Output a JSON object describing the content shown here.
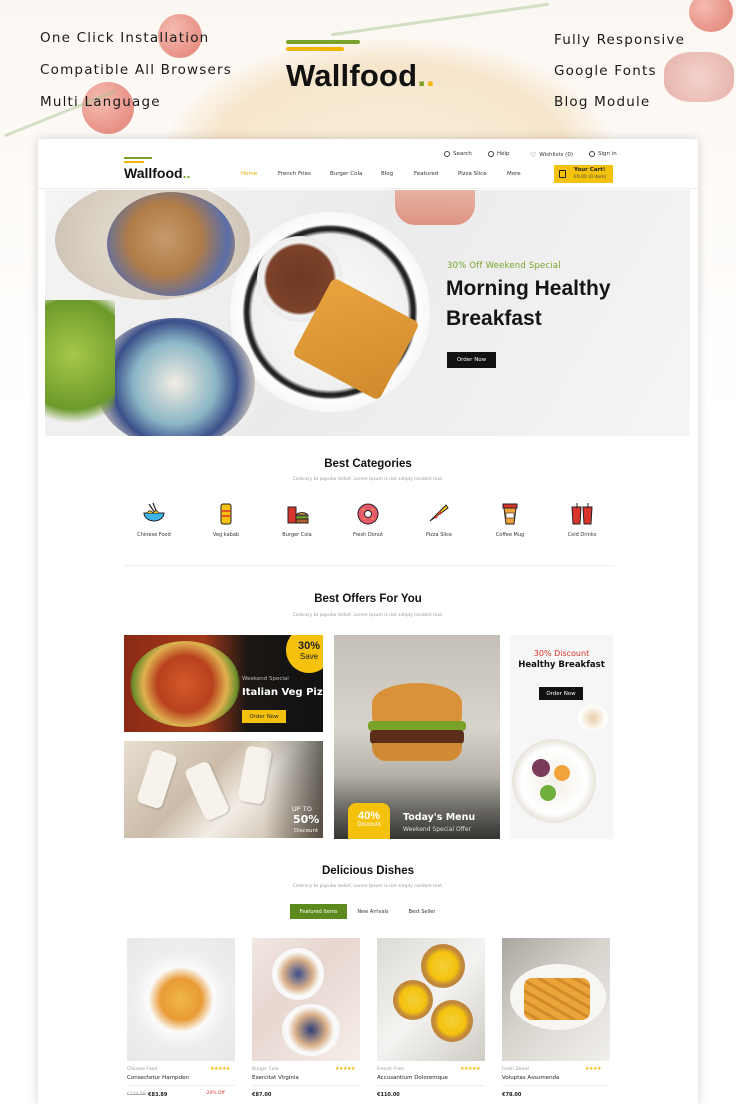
{
  "features": {
    "left": [
      "One Click Installation",
      "Compatible All Browsers",
      "Multi Language"
    ],
    "right": [
      "Fully Responsive",
      "Google Fonts",
      "Blog Module"
    ]
  },
  "brand": {
    "name": "Wallfood",
    "accent_green": "#7aa22a",
    "accent_yellow": "#f4c20d",
    "dark": "#111111"
  },
  "header": {
    "util": [
      {
        "label": "Search",
        "icon": "search-icon"
      },
      {
        "label": "Help",
        "icon": "help-icon"
      },
      {
        "label": "Wishlists (0)",
        "icon": "heart-icon"
      },
      {
        "label": "Sign in",
        "icon": "user-icon"
      }
    ],
    "nav": [
      "Home",
      "French Fries",
      "Burger Cola",
      "Blog",
      "Featured",
      "Pizza Slice",
      "More"
    ],
    "cart": {
      "title": "Your Cart!",
      "amount": "€0.00 (0 item)"
    }
  },
  "banner": {
    "subtitle": "30% Off Weekend Special",
    "title_line1": "Morning Healthy",
    "title_line2": "Breakfast",
    "button": "Order Now"
  },
  "categories": {
    "title": "Best Categories",
    "subtitle": "Contrary to popular belief, Lorem Ipsum is not simply random text.",
    "items": [
      {
        "label": "Chinese Food",
        "icon": "noodle-bowl-icon"
      },
      {
        "label": "Veg kabab",
        "icon": "wrap-icon"
      },
      {
        "label": "Burger Cola",
        "icon": "burger-cola-icon"
      },
      {
        "label": "Fresh Donut",
        "icon": "donut-icon"
      },
      {
        "label": "Pizza Slice",
        "icon": "pizza-slice-icon"
      },
      {
        "label": "Coffee Mug",
        "icon": "coffee-cup-icon"
      },
      {
        "label": "Cold Drinks",
        "icon": "cold-drink-icon"
      }
    ]
  },
  "offers": {
    "title": "Best Offers For You",
    "subtitle": "Contrary to popular belief, Lorem Ipsum is not simply random text.",
    "pizza": {
      "badge_pct": "30%",
      "badge_word": "Save",
      "tag": "Weekend Special",
      "title": "Italian Veg Pizza",
      "button": "Order Now"
    },
    "icecream": {
      "line1": "UP TO",
      "pct": "50%",
      "line2": "Discount"
    },
    "burger": {
      "pct": "40%",
      "word": "Discount",
      "title": "Today's Menu",
      "sub": "Weekend Special Offer"
    },
    "breakfast": {
      "discount": "30% Discount",
      "title": "Healthy Breakfast",
      "button": "Order Now"
    }
  },
  "dishes": {
    "title": "Delicious Dishes",
    "subtitle": "Contrary to popular belief, Lorem Ipsum is not simply random text.",
    "tabs": [
      "Featured Items",
      "New Arrivals",
      "Best Seller"
    ],
    "products": [
      {
        "category": "Chinese Food",
        "name": "Consectetur Hampden",
        "stars": "★★★★★",
        "old_price": "€104.99",
        "price": "€83.89",
        "discount": "-20% Off"
      },
      {
        "category": "Burger Cola",
        "name": "Exercitat Virginia",
        "stars": "★★★★★",
        "old_price": "",
        "price": "€87.00",
        "discount": ""
      },
      {
        "category": "French Fries",
        "name": "Accusantium Doloremque",
        "stars": "★★★★★",
        "old_price": "",
        "price": "€110.00",
        "discount": ""
      },
      {
        "category": "Fresh Donut",
        "name": "Voluptas Assumenda",
        "stars": "★★★★",
        "old_price": "",
        "price": "€78.00",
        "discount": ""
      }
    ]
  }
}
